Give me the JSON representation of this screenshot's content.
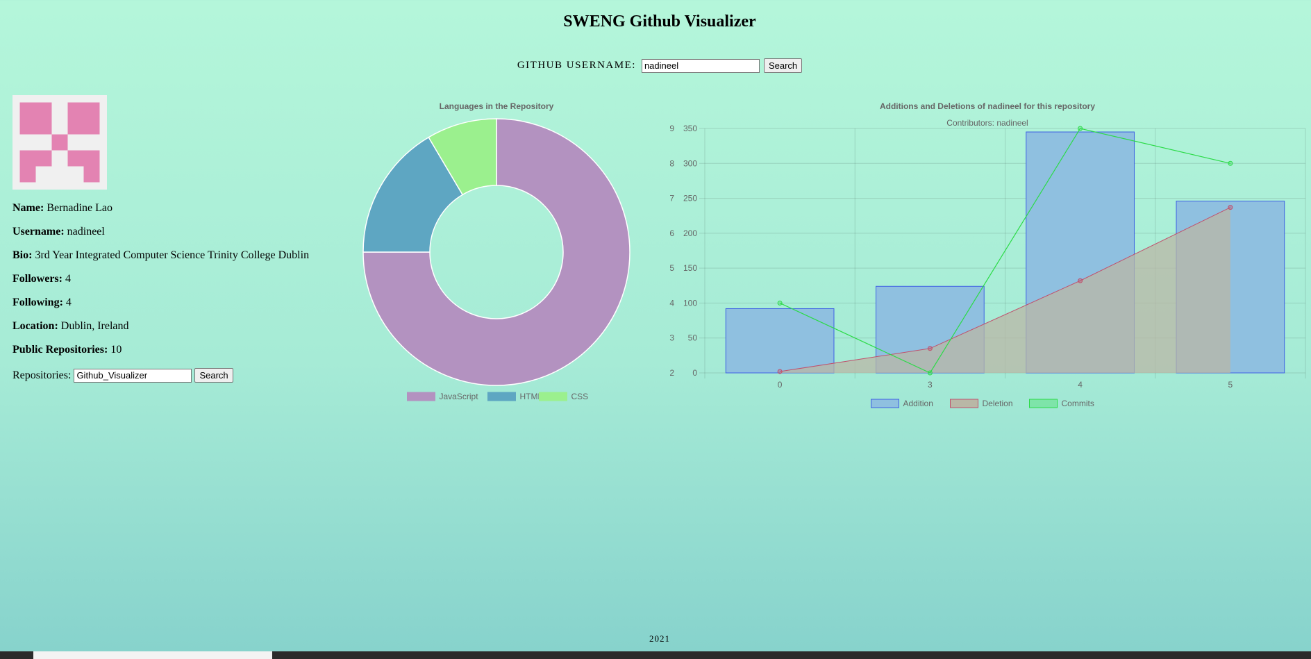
{
  "app": {
    "title": "SWENG Github Visualizer",
    "username_label": "GITHUB USERNAME:",
    "username_value": "nadineel",
    "search_label": "Search",
    "footer": "2021"
  },
  "profile": {
    "rows": [
      {
        "label": "Name:",
        "value": "Bernadine Lao"
      },
      {
        "label": "Username:",
        "value": "nadineel"
      },
      {
        "label": "Bio:",
        "value": "3rd Year Integrated Computer Science Trinity College Dublin"
      },
      {
        "label": "Followers:",
        "value": "4"
      },
      {
        "label": "Following:",
        "value": "4"
      },
      {
        "label": "Location:",
        "value": "Dublin, Ireland"
      },
      {
        "label": "Public Repositories:",
        "value": "10"
      }
    ],
    "repos_label": "Repositories:",
    "repo_value": "Github_Visualizer",
    "repo_search_label": "Search",
    "avatar_color": "#e383b2"
  },
  "chart_data": [
    {
      "type": "pie",
      "title": "Languages in the Repository",
      "labels": [
        "JavaScript",
        "HTML",
        "CSS"
      ],
      "values": [
        75,
        16.5,
        8.5
      ],
      "colors": [
        "#b392c0",
        "#5ea6c2",
        "#9bf08e"
      ],
      "donut": true,
      "legend": "bottom"
    },
    {
      "type": "bar",
      "title": "Additions and Deletions of nadineel for this repository",
      "subtitle": "Contributors: nadineel",
      "categories": [
        "0",
        "3",
        "4",
        "5"
      ],
      "series": [
        {
          "name": "Addition",
          "type": "bar",
          "axis": "right",
          "values": [
            92,
            124,
            345,
            246
          ],
          "color": "#8fc0e0",
          "border": "#3d5fe3"
        },
        {
          "name": "Deletion",
          "type": "area",
          "axis": "right",
          "values": [
            2,
            35,
            132,
            237
          ],
          "color": "#b9b7a6",
          "border": "#c0506d"
        },
        {
          "name": "Commits",
          "type": "line",
          "axis": "left",
          "values": [
            4,
            2,
            9,
            8
          ],
          "color": "#2bdb47"
        }
      ],
      "y_left": {
        "min": 2,
        "max": 9,
        "ticks": [
          2,
          3,
          4,
          5,
          6,
          7,
          8,
          9
        ]
      },
      "y_right": {
        "min": 0,
        "max": 350,
        "ticks": [
          0,
          50,
          100,
          150,
          200,
          250,
          300,
          350
        ]
      },
      "grid": true,
      "legend": "bottom"
    }
  ]
}
